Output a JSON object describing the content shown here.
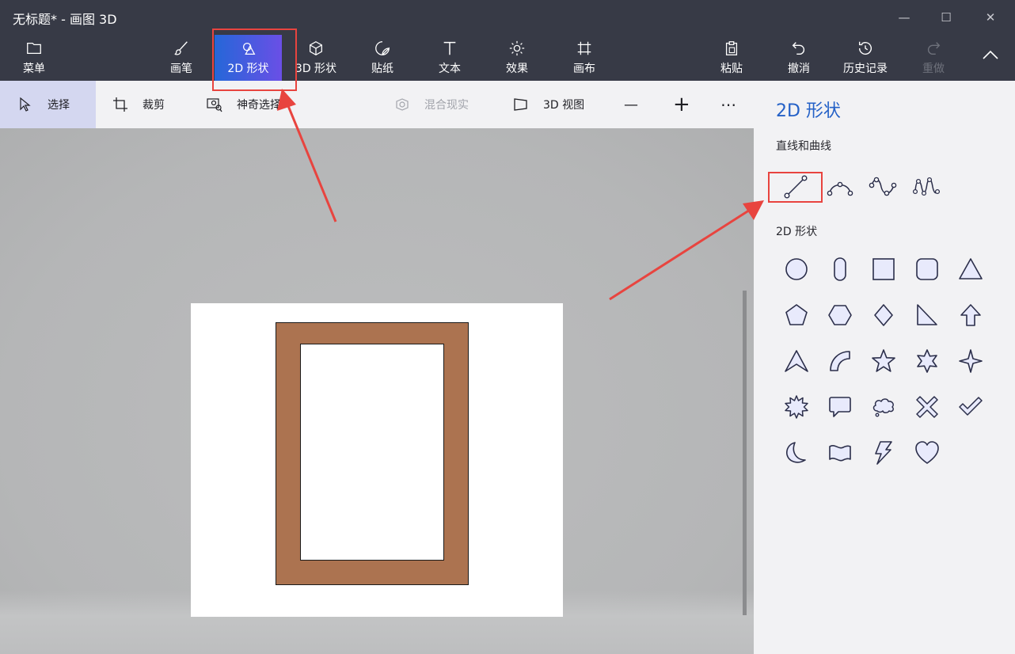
{
  "window": {
    "title": "无标题* - 画图 3D",
    "minimize_glyph": "—",
    "maximize_glyph": "☐",
    "close_glyph": "✕"
  },
  "ribbon": {
    "menu_label": "菜单",
    "brushes_label": "画笔",
    "shapes2d_label": "2D 形状",
    "shapes3d_label": "3D 形状",
    "stickers_label": "贴纸",
    "text_label": "文本",
    "effects_label": "效果",
    "canvas_label": "画布",
    "paste_label": "粘贴",
    "undo_label": "撤消",
    "history_label": "历史记录",
    "redo_label": "重做",
    "active_tab": "2D 形状"
  },
  "toolbar": {
    "select_label": "选择",
    "crop_label": "裁剪",
    "magic_select_label": "神奇选择",
    "mixed_reality_label": "混合现实",
    "view3d_label": "3D 视图",
    "zoom_out_glyph": "—",
    "zoom_in_glyph": "+",
    "more_glyph": "⋯"
  },
  "panel": {
    "title": "2D 形状",
    "lines_section": "直线和曲线",
    "line_tools": [
      "line-icon",
      "curve-1-icon",
      "curve-2-icon",
      "curve-3-icon"
    ],
    "shapes_section": "2D 形状",
    "shapes": [
      "circle-icon",
      "pill-icon",
      "square-icon",
      "rounded-square-icon",
      "triangle-icon",
      "pentagon-icon",
      "hexagon-icon",
      "diamond-icon",
      "right-triangle-icon",
      "arrow-up-icon",
      "arrowhead-icon",
      "quarter-arc-icon",
      "star5-icon",
      "star6-icon",
      "star4-icon",
      "burst-icon",
      "speech-bubble-icon",
      "thought-bubble-icon",
      "x-mark-icon",
      "check-mark-icon",
      "moon-icon",
      "banner-icon",
      "lightning-icon",
      "heart-icon"
    ]
  },
  "colors": {
    "chrome": "#373a46",
    "active_gradient_start": "#2567d8",
    "active_gradient_end": "#6a4fe6",
    "panel_bg": "#f2f2f4",
    "accent_text": "#2461c7",
    "frame_fill": "#ac7350",
    "annotation_red": "#e8443f",
    "icon_stroke": "#2b2e4a",
    "icon_fill": "#e8eafc"
  }
}
